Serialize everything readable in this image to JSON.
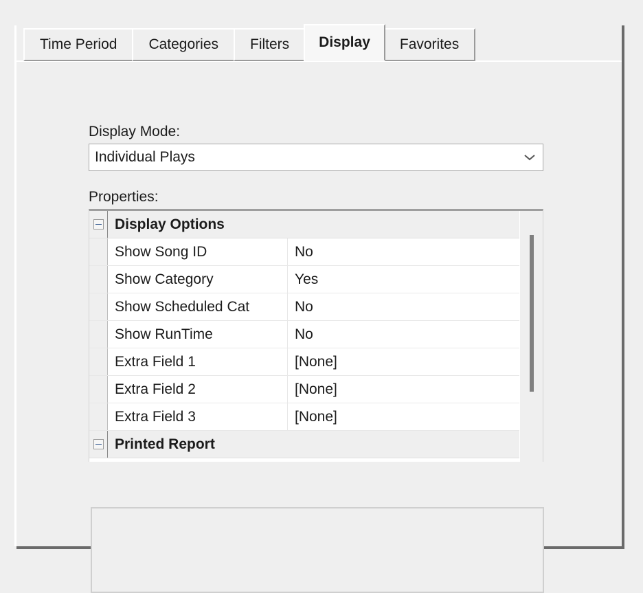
{
  "dialog": {
    "tabs": [
      {
        "label": "Time Period",
        "selected": false
      },
      {
        "label": "Categories",
        "selected": false
      },
      {
        "label": "Filters",
        "selected": false
      },
      {
        "label": "Display",
        "selected": true
      },
      {
        "label": "Favorites",
        "selected": false
      }
    ]
  },
  "display_tab": {
    "display_mode": {
      "label": "Display Mode:",
      "value": "Individual Plays",
      "dropdown_icon": "chevron-down-icon"
    },
    "properties": {
      "label": "Properties:",
      "rows": [
        {
          "type": "category",
          "name": "Display Options",
          "value": "",
          "expander": "collapse-minus-icon"
        },
        {
          "type": "property",
          "name": "Show Song ID",
          "value": "No"
        },
        {
          "type": "property",
          "name": "Show Category",
          "value": "Yes"
        },
        {
          "type": "property",
          "name": "Show Scheduled Cat",
          "value": "No"
        },
        {
          "type": "property",
          "name": "Show RunTime",
          "value": "No"
        },
        {
          "type": "property",
          "name": "Extra Field 1",
          "value": "[None]"
        },
        {
          "type": "property",
          "name": "Extra Field 2",
          "value": "[None]"
        },
        {
          "type": "property",
          "name": "Extra Field 3",
          "value": "[None]"
        },
        {
          "type": "category",
          "name": "Printed Report",
          "value": "",
          "expander": "collapse-minus-icon"
        }
      ]
    },
    "description_panel": {
      "text": ""
    }
  },
  "colors": {
    "window_background": "#efefef",
    "grid_background": "#ffffff",
    "grid_category_background": "#efefef",
    "text": "#1b1b1b",
    "border": "#9a9a9a",
    "scrollbar_thumb": "#808080",
    "expander_glyph": "#31578f"
  }
}
